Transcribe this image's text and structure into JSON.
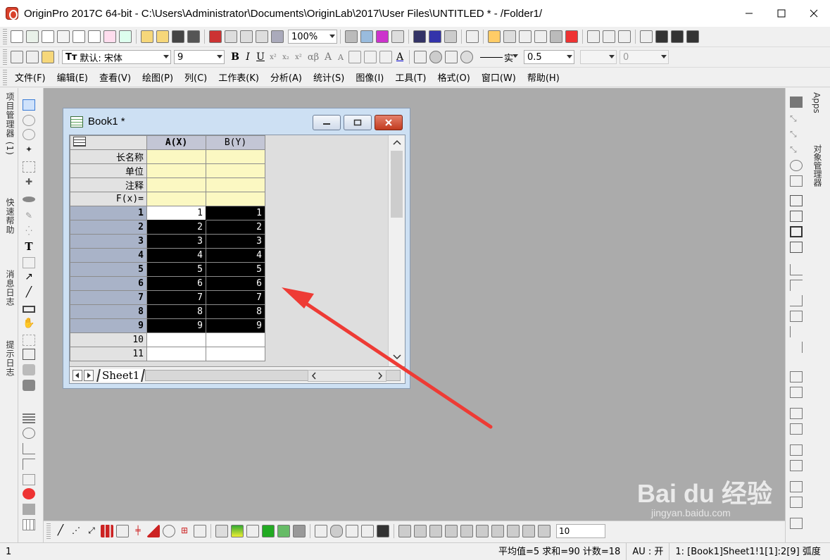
{
  "window": {
    "title": "OriginPro 2017C 64-bit - C:\\Users\\Administrator\\Documents\\OriginLab\\2017\\User Files\\UNTITLED * - /Folder1/"
  },
  "toolbar": {
    "zoom": "100%",
    "font_prefix": "Tт",
    "font_name": "默认: 宋体",
    "font_size": "9",
    "bold": "B",
    "italic": "I",
    "underline": "U",
    "line_style_label": "实",
    "line_width": "0.5",
    "box_value": "0",
    "greek_label": "αβ"
  },
  "menu": [
    "文件(F)",
    "编辑(E)",
    "查看(V)",
    "绘图(P)",
    "列(C)",
    "工作表(K)",
    "分析(A)",
    "统计(S)",
    "图像(I)",
    "工具(T)",
    "格式(O)",
    "窗口(W)",
    "帮助(H)"
  ],
  "left_dock": {
    "project_manager": "项目管理器 (1)",
    "quick_help": "快速帮助",
    "message_log": "消息日志",
    "hint_log": "提示日志"
  },
  "right_dock": {
    "apps": "Apps",
    "object_manager": "对象管理器"
  },
  "book": {
    "title": "Book1 *",
    "columns": [
      "A(X)",
      "B(Y)"
    ],
    "meta_rows": [
      "长名称",
      "单位",
      "注释",
      "F(x)="
    ],
    "rows": [
      {
        "idx": "1",
        "a": "1",
        "b": "1"
      },
      {
        "idx": "2",
        "a": "2",
        "b": "2"
      },
      {
        "idx": "3",
        "a": "3",
        "b": "3"
      },
      {
        "idx": "4",
        "a": "4",
        "b": "4"
      },
      {
        "idx": "5",
        "a": "5",
        "b": "5"
      },
      {
        "idx": "6",
        "a": "6",
        "b": "6"
      },
      {
        "idx": "7",
        "a": "7",
        "b": "7"
      },
      {
        "idx": "8",
        "a": "8",
        "b": "8"
      },
      {
        "idx": "9",
        "a": "9",
        "b": "9"
      }
    ],
    "empty_rows": [
      "10",
      "11"
    ],
    "sheet_tab": "Sheet1"
  },
  "bottom_toolbar": {
    "zoom_value": "10"
  },
  "status": {
    "left": "1",
    "stats": "平均值=5 求和=90 计数=18",
    "au": "AU : 开",
    "location": "1: [Book1]Sheet1!1[1]:2[9] 弧度"
  },
  "watermark": {
    "brand": "Bai du 经验",
    "url": "jingyan.baidu.com"
  },
  "colors": {
    "annotation_arrow": "#ee3b35",
    "selection": "#000000",
    "meta_row_fill": "#fbf8c2",
    "workspace": "#ababab"
  }
}
